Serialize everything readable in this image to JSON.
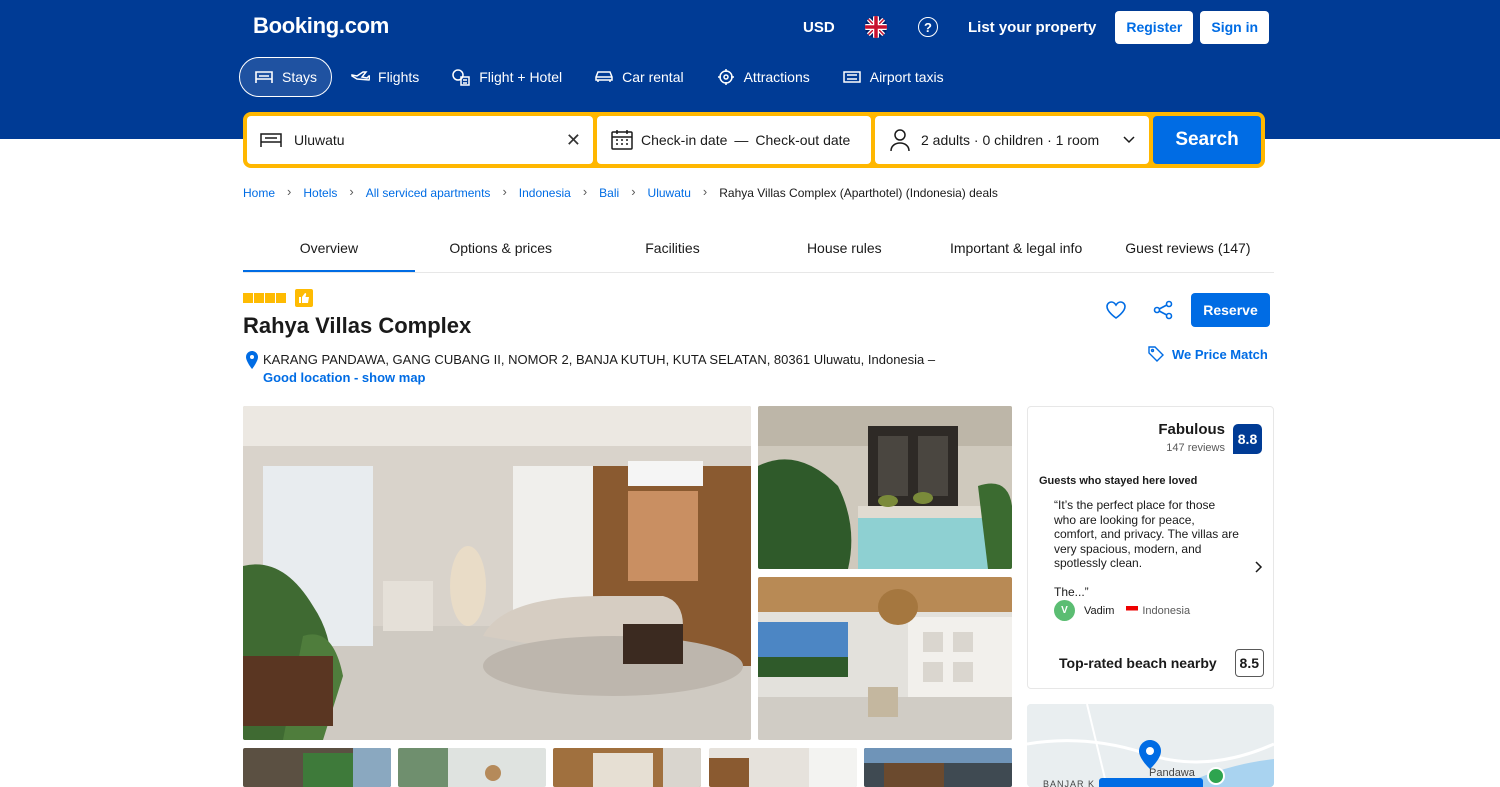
{
  "header": {
    "logo": "Booking.com",
    "currency": "USD",
    "help": "?",
    "list_property": "List your property",
    "register": "Register",
    "sign_in": "Sign in"
  },
  "nav": {
    "items": [
      {
        "label": "Stays",
        "icon": "bed-icon"
      },
      {
        "label": "Flights",
        "icon": "plane-icon"
      },
      {
        "label": "Flight + Hotel",
        "icon": "flight-hotel-icon"
      },
      {
        "label": "Car rental",
        "icon": "car-icon"
      },
      {
        "label": "Attractions",
        "icon": "attractions-icon"
      },
      {
        "label": "Airport taxis",
        "icon": "taxi-icon"
      }
    ]
  },
  "search": {
    "destination": "Uluwatu",
    "checkin": "Check-in date",
    "dash": "—",
    "checkout": "Check-out date",
    "guests": "2 adults · 0 children · 1 room",
    "button": "Search"
  },
  "breadcrumb": [
    "Home",
    "Hotels",
    "All serviced apartments",
    "Indonesia",
    "Bali",
    "Uluwatu",
    "Rahya Villas Complex (Aparthotel) (Indonesia) deals"
  ],
  "tabs": [
    "Overview",
    "Options & prices",
    "Facilities",
    "House rules",
    "Important & legal info",
    "Guest reviews (147)"
  ],
  "hotel": {
    "stars": 4,
    "name": "Rahya Villas Complex",
    "address": "KARANG PANDAWA, GANG CUBANG II, NOMOR 2, BANJA KUTUH, KUTA SELATAN, 80361 Uluwatu, Indonesia –",
    "map_link": "Good location - show map",
    "reserve": "Reserve",
    "price_match": "We Price Match"
  },
  "reviews": {
    "word": "Fabulous",
    "count": "147 reviews",
    "score": "8.8",
    "loved_heading": "Guests who stayed here loved",
    "quote": "“It’s the perfect place for those who are looking for peace, comfort, and privacy. The villas are very spacious, modern, and spotlessly clean.",
    "quote_end": "The...”",
    "reviewer_initial": "V",
    "reviewer_name": "Vadim",
    "reviewer_country": "Indonesia",
    "beach_label": "Top-rated beach nearby",
    "beach_score": "8.5"
  },
  "map": {
    "label1": "Pandawa",
    "label2": "BANJAR K"
  },
  "colors": {
    "brand_blue": "#003b95",
    "action_blue": "#006ce4",
    "search_yellow": "#ffb700"
  }
}
